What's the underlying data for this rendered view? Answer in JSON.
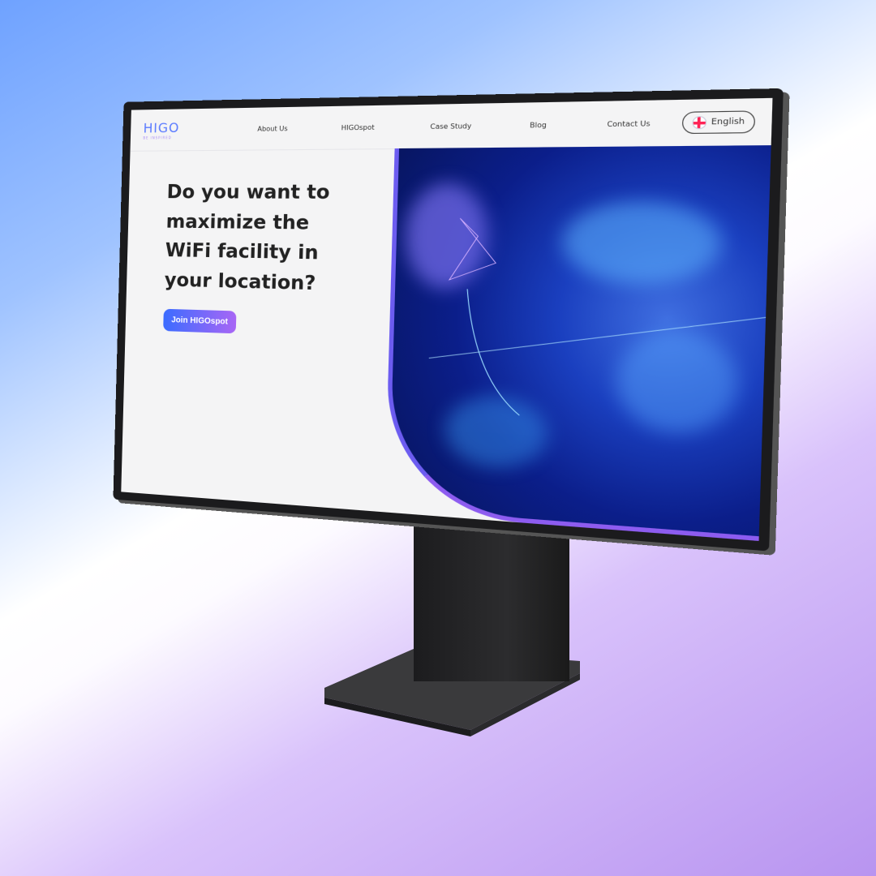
{
  "brand": {
    "name": "HIGO",
    "tagline": "BE INSPIRED",
    "color": "#5b7bff"
  },
  "nav": {
    "items": [
      "About Us",
      "HIGOspot",
      "Case Study",
      "Blog",
      "Contact Us"
    ],
    "language": "English",
    "language_icon": "uk-flag-icon"
  },
  "hero": {
    "headline": "Do you want to maximize the WiFi facility in your location?",
    "cta": "Join HIGOspot"
  },
  "colors": {
    "cta_start": "#3b6cff",
    "cta_end": "#a866f5"
  }
}
